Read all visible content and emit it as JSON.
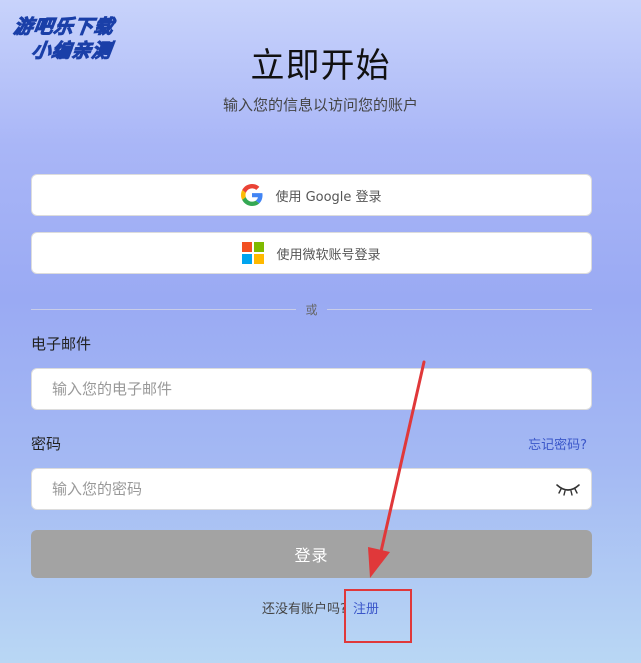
{
  "watermark": {
    "line1": "游吧乐下载",
    "line2": "小编亲测"
  },
  "header": {
    "title": "立即开始",
    "subtitle": "输入您的信息以访问您的账户"
  },
  "sso": {
    "google_label": "使用 Google 登录",
    "microsoft_label": "使用微软账号登录"
  },
  "divider": {
    "text": "或"
  },
  "form": {
    "email_label": "电子邮件",
    "email_placeholder": "输入您的电子邮件",
    "password_label": "密码",
    "password_placeholder": "输入您的密码",
    "forgot_label": "忘记密码?",
    "login_label": "登录"
  },
  "footer": {
    "no_account_text": "还没有账户吗?",
    "signup_label": "注册"
  },
  "colors": {
    "accent": "#3a56c9",
    "login_button": "#a3a3a3",
    "annotation": "#e0383a"
  },
  "icons": {
    "google": "google-logo-icon",
    "microsoft": "microsoft-logo-icon",
    "password_toggle": "eye-closed-icon"
  }
}
